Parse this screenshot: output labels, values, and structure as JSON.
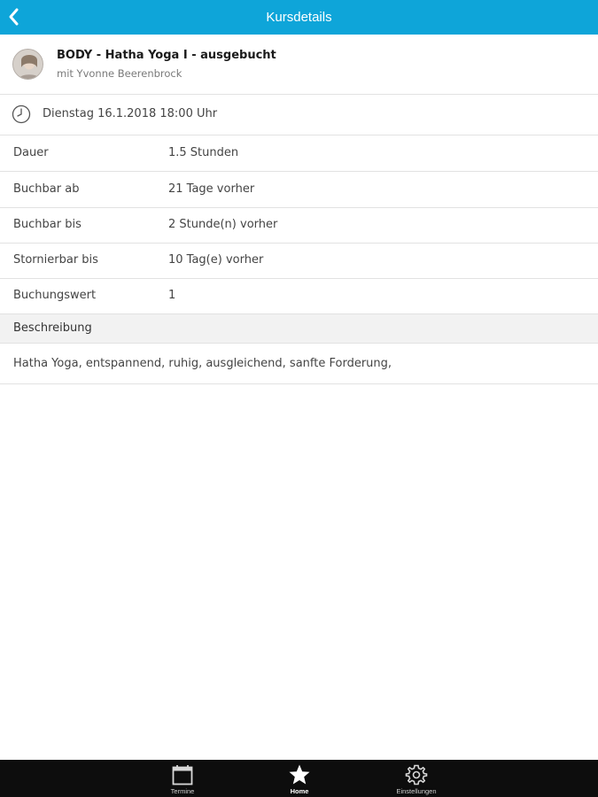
{
  "header": {
    "title": "Kursdetails",
    "back_icon": "chevron-left-icon",
    "background_color": "#0ea5d9"
  },
  "course": {
    "title": "BODY - Hatha Yoga I - ausgebucht",
    "instructor": "mit Yvonne Beerenbrock",
    "datetime": "Dienstag 16.1.2018 18:00 Uhr"
  },
  "details": [
    {
      "label": "Dauer",
      "value": "1.5 Stunden"
    },
    {
      "label": "Buchbar ab",
      "value": "21 Tage vorher"
    },
    {
      "label": "Buchbar bis",
      "value": "2 Stunde(n) vorher"
    },
    {
      "label": "Stornierbar bis",
      "value": "10 Tag(e) vorher"
    },
    {
      "label": "Buchungswert",
      "value": "1"
    }
  ],
  "description": {
    "heading": "Beschreibung",
    "text": "Hatha Yoga, entspannend, ruhig, ausgleichend, sanfte Forderung,"
  },
  "tabbar": {
    "items": [
      {
        "label": "Termine",
        "icon": "calendar-icon",
        "active": false
      },
      {
        "label": "Home",
        "icon": "star-icon",
        "active": true
      },
      {
        "label": "Einstellungen",
        "icon": "gear-icon",
        "active": false
      }
    ]
  }
}
